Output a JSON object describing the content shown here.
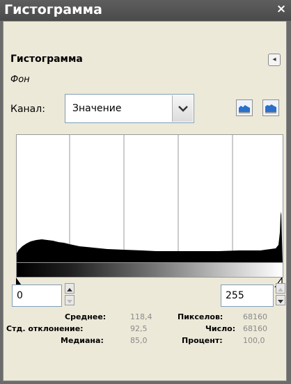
{
  "window": {
    "title": "Гистограмма",
    "close_label": "×"
  },
  "panel": {
    "title": "Гистограмма",
    "subtitle": "Фон"
  },
  "channel": {
    "label": "Канал:",
    "value": "Значение"
  },
  "range": {
    "start": "0",
    "end": "255"
  },
  "stats": {
    "mean_label": "Среднее:",
    "mean_value": "118,4",
    "std_label": "Стд. отклонение:",
    "std_value": "92,5",
    "median_label": "Медиана:",
    "median_value": "85,0",
    "pixels_label": "Пикселов:",
    "pixels_value": "68160",
    "count_label": "Число:",
    "count_value": "68160",
    "percent_label": "Процент:",
    "percent_value": "100,0"
  },
  "colors": {
    "accent": "#4a4a4a",
    "hist_fill": "#000000"
  },
  "icons": {
    "close": "close-icon",
    "panel_menu": "panel-menu-icon",
    "dropdown": "chevron-down-icon",
    "linear_scale": "linear-histogram-icon",
    "log_scale": "log-histogram-icon"
  }
}
